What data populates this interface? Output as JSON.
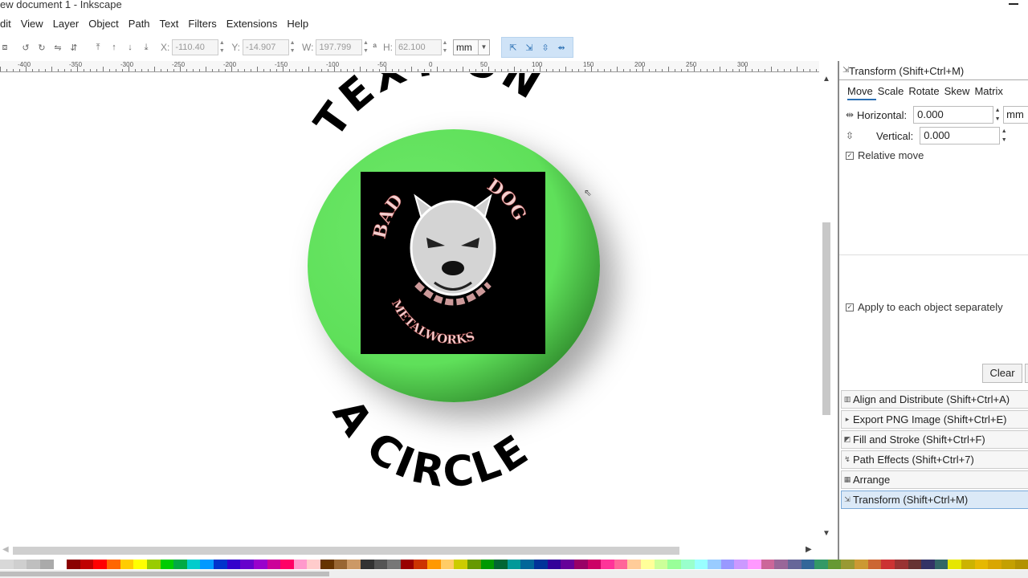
{
  "window": {
    "title": "ew document 1 - Inkscape"
  },
  "menubar": {
    "items": [
      "dit",
      "View",
      "Layer",
      "Object",
      "Path",
      "Text",
      "Filters",
      "Extensions",
      "Help"
    ]
  },
  "toolbar": {
    "x_label": "X:",
    "x_value": "-110.40",
    "y_label": "Y:",
    "y_value": "-14.907",
    "w_label": "W:",
    "w_value": "197.799",
    "h_label": "H:",
    "h_value": "62.100",
    "unit": "mm"
  },
  "ruler": {
    "labels": [
      "-400",
      "-350",
      "-300",
      "-250",
      "-200",
      "-150",
      "-100",
      "-50",
      "0",
      "50",
      "100",
      "150",
      "200",
      "250",
      "300"
    ]
  },
  "artwork": {
    "top_text": "TEXT ON",
    "bottom_text": "A CIRCLE",
    "logo_top_left": "BAD",
    "logo_top_right": "DOG",
    "logo_bottom": "METALWORKS",
    "colors": {
      "disc": "#5fe05a",
      "logo_bg": "#000000",
      "logo_text": "#f3cfcf"
    }
  },
  "transform_panel": {
    "title": "Transform (Shift+Ctrl+M)",
    "tabs": [
      "Move",
      "Scale",
      "Rotate",
      "Skew",
      "Matrix"
    ],
    "active_tab": "Move",
    "horizontal_label": "Horizontal:",
    "horizontal_value": "0.000",
    "horizontal_unit": "mm",
    "vertical_label": "Vertical:",
    "vertical_value": "0.000",
    "relative_move": "Relative move",
    "apply_each": "Apply to each object separately",
    "clear_label": "Clear"
  },
  "dock_items": [
    {
      "label": "Align and Distribute (Shift+Ctrl+A)",
      "icon": "align-icon"
    },
    {
      "label": "Export PNG Image (Shift+Ctrl+E)",
      "icon": "export-icon"
    },
    {
      "label": "Fill and Stroke (Shift+Ctrl+F)",
      "icon": "fill-stroke-icon"
    },
    {
      "label": "Path Effects  (Shift+Ctrl+7)",
      "icon": "path-effects-icon"
    },
    {
      "label": "Arrange",
      "icon": "arrange-icon"
    },
    {
      "label": "Transform (Shift+Ctrl+M)",
      "icon": "transform-icon",
      "active": true
    }
  ],
  "palette": [
    "#d8d8d8",
    "#cfcfcf",
    "#bfbfbf",
    "#aaaaaa",
    "#ffffff",
    "#8b0000",
    "#c00000",
    "#ff0000",
    "#ff6600",
    "#ffcc00",
    "#ffff00",
    "#99cc00",
    "#00cc00",
    "#00aa44",
    "#00cccc",
    "#0099ff",
    "#0033cc",
    "#3300cc",
    "#6600cc",
    "#9900cc",
    "#cc0099",
    "#ff0066",
    "#ff99cc",
    "#ffcccc",
    "#663300",
    "#996633",
    "#cc9966",
    "#333333",
    "#555555",
    "#777777",
    "#990000",
    "#cc3300",
    "#ff9900",
    "#ffcc66",
    "#cccc00",
    "#669900",
    "#009900",
    "#006633",
    "#009999",
    "#006699",
    "#003399",
    "#330099",
    "#660099",
    "#990066",
    "#cc0066",
    "#ff3399",
    "#ff6699",
    "#ffcc99",
    "#ffff99",
    "#ccff99",
    "#99ff99",
    "#99ffcc",
    "#99ffff",
    "#99ccff",
    "#9999ff",
    "#cc99ff",
    "#ff99ff",
    "#cc6699",
    "#996699",
    "#666699",
    "#336699",
    "#339966",
    "#669933",
    "#999933",
    "#cc9933",
    "#cc6633",
    "#cc3333",
    "#993333",
    "#663333",
    "#333366",
    "#336666",
    "#e6e600",
    "#ccb300",
    "#e6b800",
    "#d9a600",
    "#c4a000",
    "#b39200"
  ]
}
